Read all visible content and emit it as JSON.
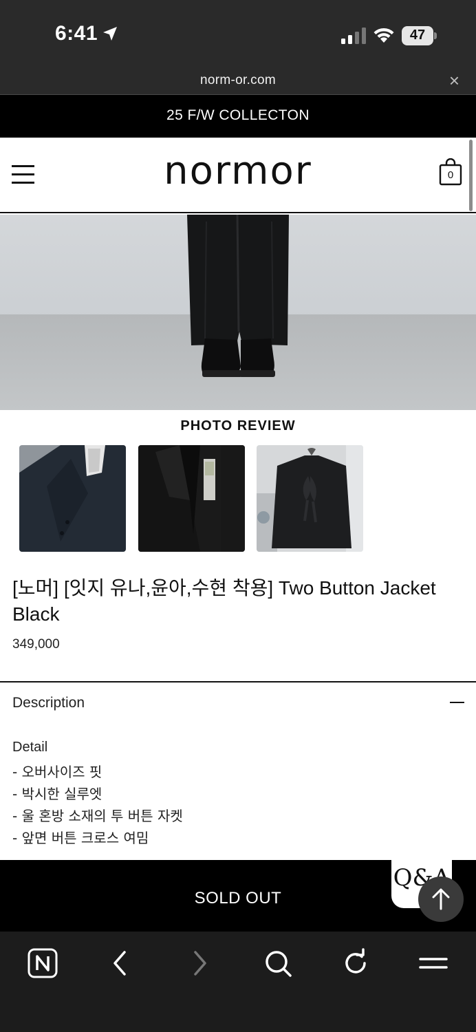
{
  "status_bar": {
    "time": "6:41",
    "battery": "47"
  },
  "browser": {
    "url": "norm-or.com",
    "close_icon": "×"
  },
  "announcement": {
    "text": "25 F/W COLLECTON"
  },
  "header": {
    "logo": "normor",
    "cart_count": "0"
  },
  "photo_review": {
    "title": "PHOTO REVIEW"
  },
  "product": {
    "title": "[노머] [잇지 유나,윤아,수현 착용] Two Button Jacket Black",
    "price": "349,000"
  },
  "description": {
    "header": "Description",
    "detail_heading": "Detail",
    "details": [
      "- 오버사이즈 핏",
      "- 박시한 실루엣",
      "- 울 혼방 소재의 투 버튼 자켓",
      "- 앞면 버튼 크로스 여밈"
    ]
  },
  "actions": {
    "sold_out": "SOLD OUT",
    "qa_label": "Q&A"
  },
  "icons": {
    "status": [
      "location-arrow-icon",
      "signal-icon",
      "wifi-icon",
      "battery-icon"
    ],
    "header": [
      "hamburger-menu-icon",
      "shopping-bag-icon"
    ],
    "bottom_nav": [
      "naver-icon",
      "back-icon",
      "forward-icon",
      "search-icon",
      "refresh-icon",
      "menu-icon"
    ]
  },
  "colors": {
    "dark_chrome": "#2a2a2a",
    "announcement_bg": "#000000",
    "sold_out_bg": "#000000",
    "bottom_nav_bg": "#1c1c1c"
  }
}
